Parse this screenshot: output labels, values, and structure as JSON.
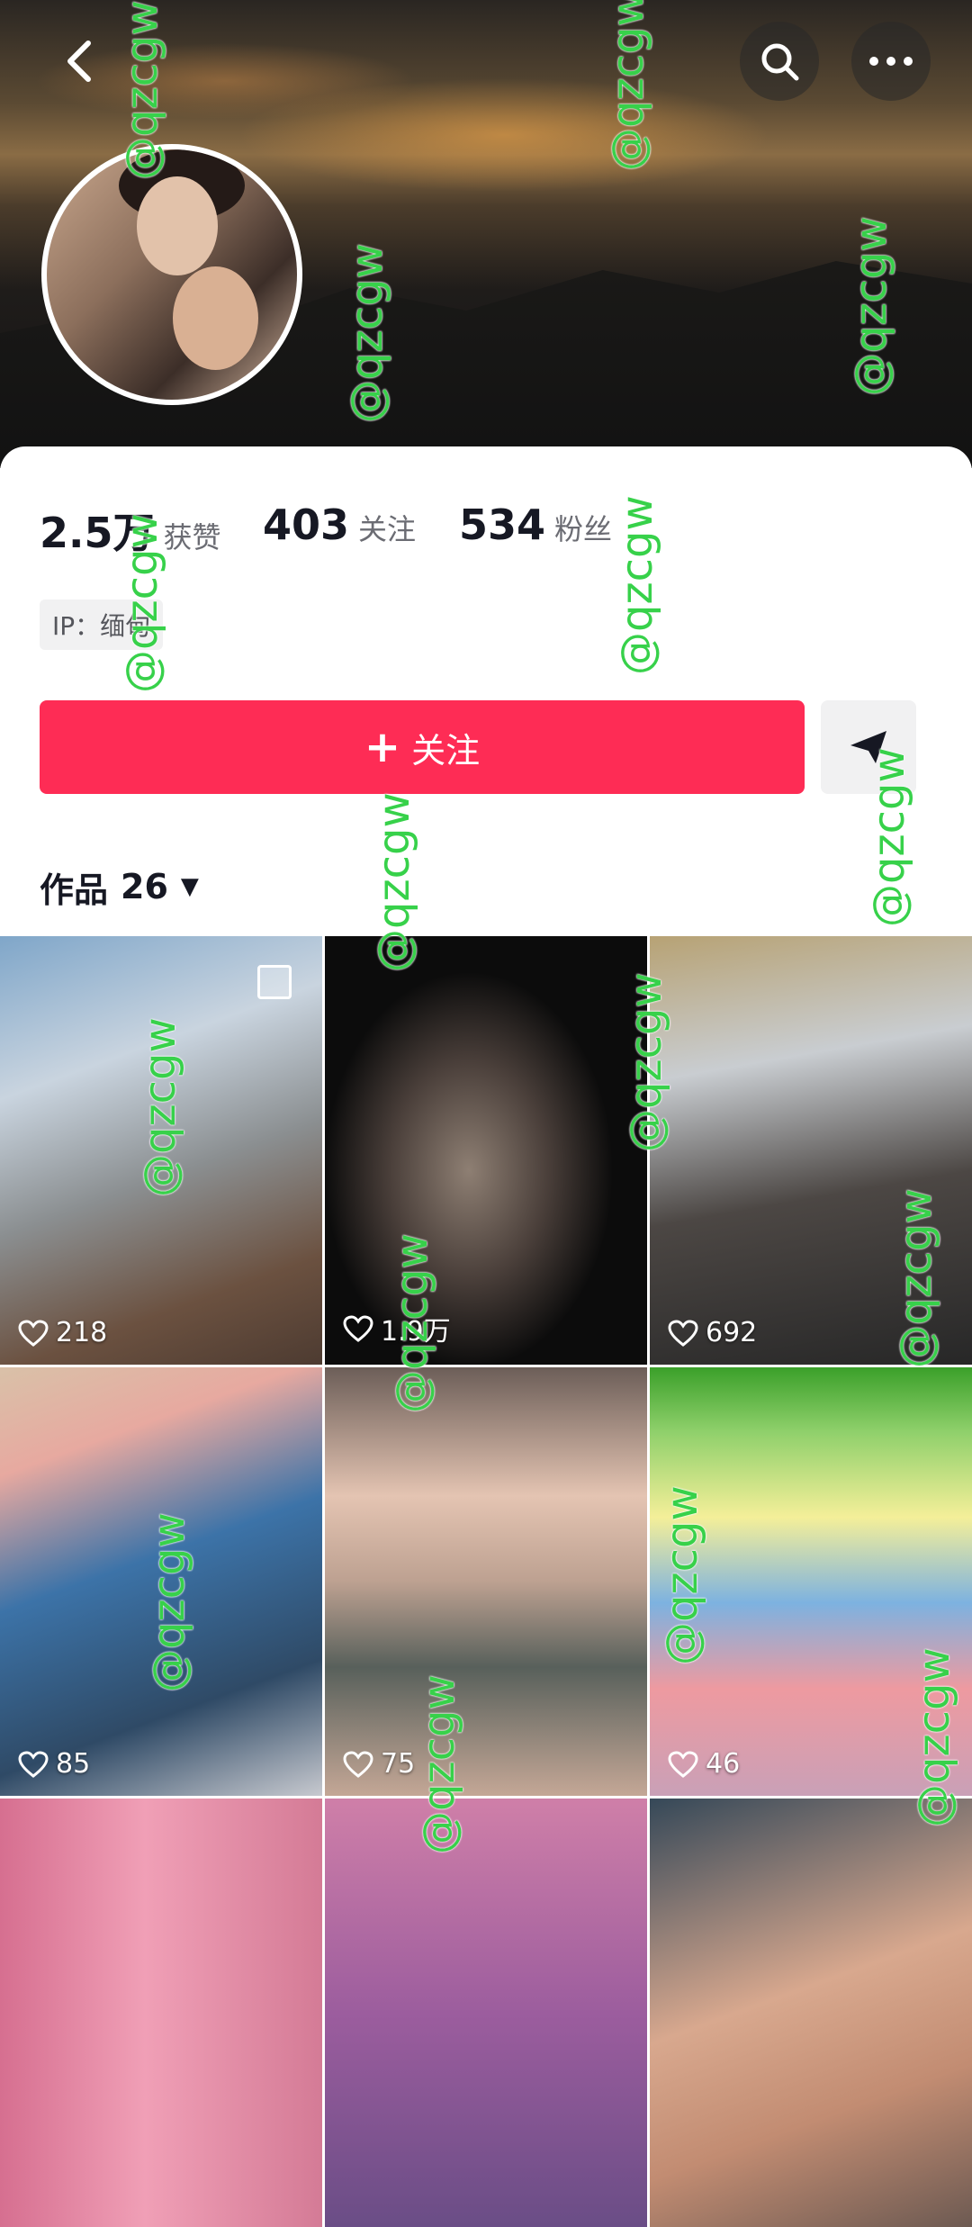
{
  "header": {
    "back_icon": "chevron-left-icon",
    "search_icon": "search-icon",
    "more_icon": "ellipsis-icon"
  },
  "stats": [
    {
      "value": "2.5万",
      "label": "获赞"
    },
    {
      "value": "403",
      "label": "关注"
    },
    {
      "value": "534",
      "label": "粉丝"
    }
  ],
  "ip_tag": "IP：缅甸",
  "follow_button": {
    "plus": "+",
    "label": "关注"
  },
  "share_icon": "send-icon",
  "works_tab": {
    "label": "作品",
    "count": "26"
  },
  "videos": [
    {
      "likes": "218"
    },
    {
      "likes": "1.9万"
    },
    {
      "likes": "692"
    },
    {
      "likes": "85"
    },
    {
      "likes": "75"
    },
    {
      "likes": "46"
    },
    {
      "likes": ""
    },
    {
      "likes": ""
    },
    {
      "likes": ""
    }
  ],
  "watermark": "@qzcgw",
  "colors": {
    "accent": "#fe2c55",
    "text": "#161823",
    "muted": "#6b6c73"
  }
}
